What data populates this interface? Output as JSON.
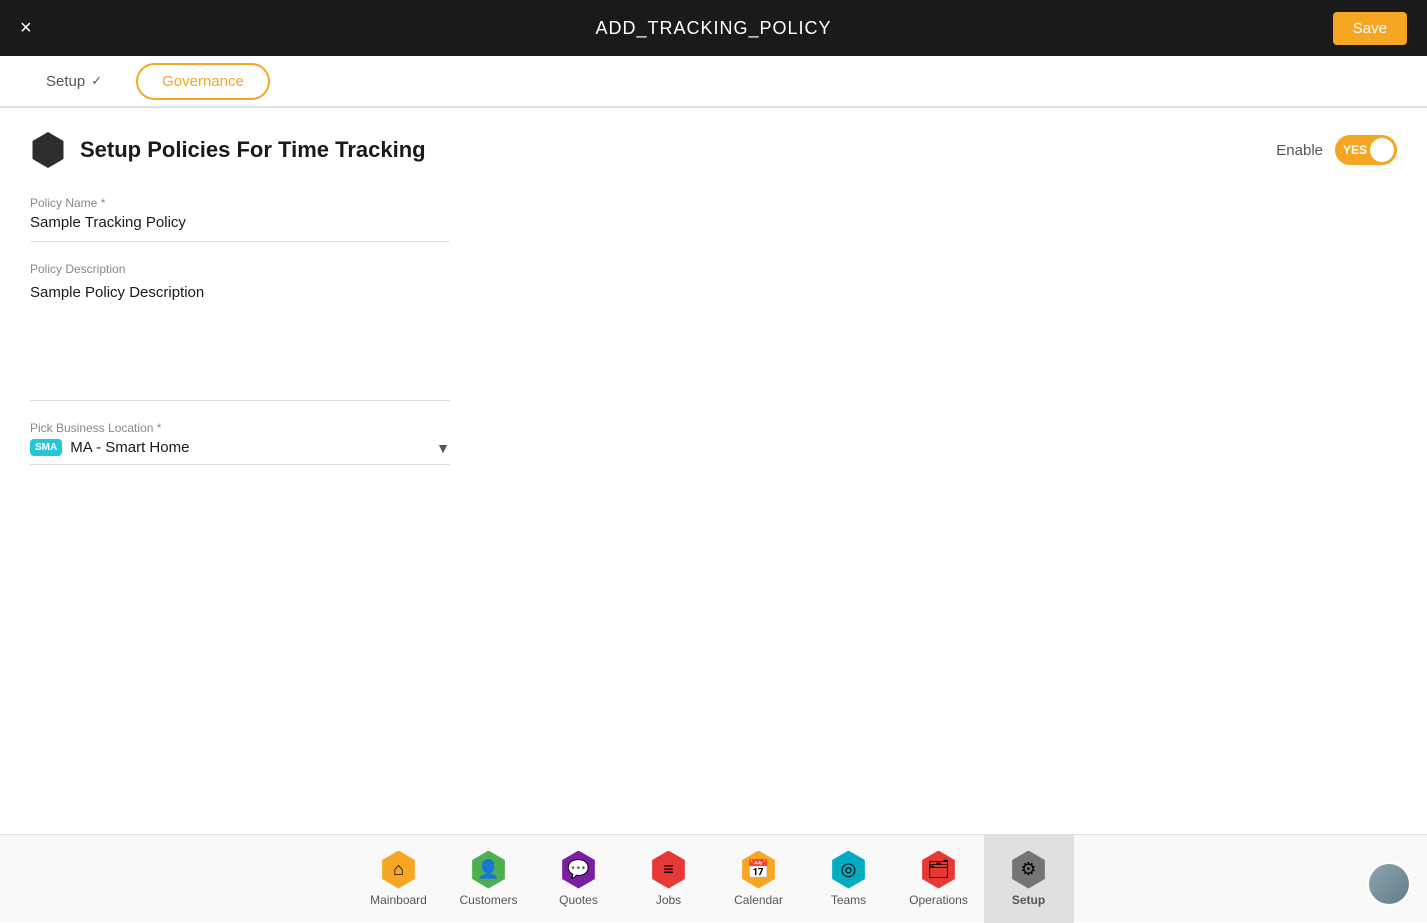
{
  "header": {
    "title": "ADD_TRACKING_POLICY",
    "close_label": "×",
    "save_label": "Save"
  },
  "tabs": [
    {
      "id": "setup",
      "label": "Setup",
      "state": "completed"
    },
    {
      "id": "governance",
      "label": "Governance",
      "state": "active"
    }
  ],
  "section": {
    "title": "Setup Policies For Time Tracking",
    "enable_label": "Enable",
    "toggle_label": "YES"
  },
  "form": {
    "policy_name_label": "Policy Name *",
    "policy_name_value": "Sample Tracking Policy",
    "policy_description_label": "Policy Description",
    "policy_description_value": "Sample Policy Description",
    "business_location_label": "Pick Business Location *",
    "business_location_badge": "SMA",
    "business_location_value": "MA - Smart Home"
  },
  "bottom_nav": {
    "items": [
      {
        "id": "mainboard",
        "label": "Mainboard",
        "icon": "⌂",
        "icon_class": "nav-icon-mainboard",
        "active": false
      },
      {
        "id": "customers",
        "label": "Customers",
        "icon": "👤",
        "icon_class": "nav-icon-customers",
        "active": false
      },
      {
        "id": "quotes",
        "label": "Quotes",
        "icon": "💬",
        "icon_class": "nav-icon-quotes",
        "active": false
      },
      {
        "id": "jobs",
        "label": "Jobs",
        "icon": "≡",
        "icon_class": "nav-icon-jobs",
        "active": false
      },
      {
        "id": "calendar",
        "label": "Calendar",
        "icon": "📅",
        "icon_class": "nav-icon-calendar",
        "active": false
      },
      {
        "id": "teams",
        "label": "Teams",
        "icon": "◎",
        "icon_class": "nav-icon-teams",
        "active": false
      },
      {
        "id": "operations",
        "label": "Operations",
        "icon": "🗂",
        "icon_class": "nav-icon-operations",
        "active": false
      },
      {
        "id": "setup",
        "label": "Setup",
        "icon": "⚙",
        "icon_class": "nav-icon-setup",
        "active": true
      }
    ]
  }
}
